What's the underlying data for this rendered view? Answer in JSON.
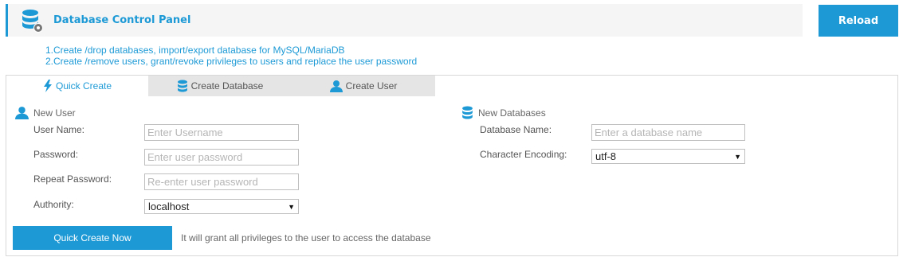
{
  "header": {
    "title": "Database Control Panel",
    "icon": "database-gear-icon",
    "reload_label": "Reload"
  },
  "intro": {
    "line1": "1.Create /drop databases, import/export database for MySQL/MariaDB",
    "line2": "2.Create /remove users, grant/revoke privileges to users and replace the user password"
  },
  "tabs": [
    {
      "label": "Quick Create",
      "icon": "lightning-icon",
      "active": true
    },
    {
      "label": "Create Database",
      "icon": "database-icon",
      "active": false
    },
    {
      "label": "Create User",
      "icon": "user-icon",
      "active": false
    }
  ],
  "new_user": {
    "title": "New User",
    "username": {
      "label": "User Name:",
      "placeholder": "Enter Username",
      "value": ""
    },
    "password": {
      "label": "Password:",
      "placeholder": "Enter user password",
      "value": ""
    },
    "repeat_password": {
      "label": "Repeat Password:",
      "placeholder": "Re-enter user password",
      "value": ""
    },
    "authority": {
      "label": "Authority:",
      "selected": "localhost"
    }
  },
  "new_databases": {
    "title": "New Databases",
    "database_name": {
      "label": "Database Name:",
      "placeholder": "Enter a database name",
      "value": ""
    },
    "encoding": {
      "label": "Character Encoding:",
      "selected": "utf-8"
    }
  },
  "actions": {
    "quick_create_label": "Quick Create Now",
    "hint": "It will grant all privileges to the user to access the database"
  },
  "colors": {
    "accent": "#1d9ad6",
    "tab_inactive_bg": "#e5e5e5",
    "header_bg": "#f5f5f5"
  }
}
